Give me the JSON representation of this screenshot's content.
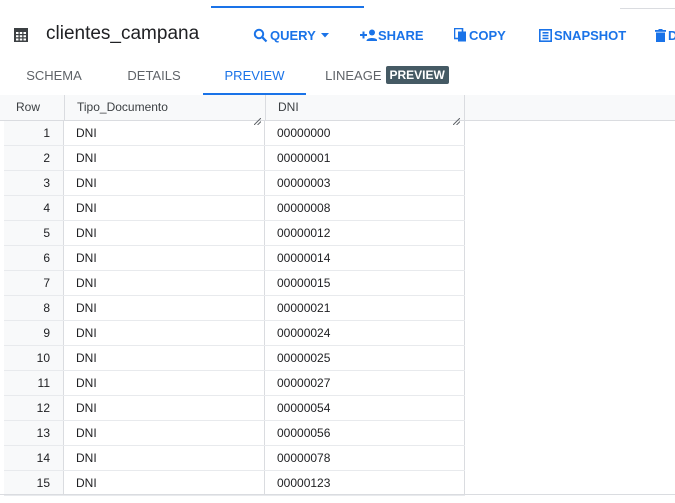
{
  "table": {
    "name": "clientes_campana"
  },
  "toolbar": {
    "query_label": "QUERY",
    "share_label": "SHARE",
    "copy_label": "COPY",
    "snapshot_label": "SNAPSHOT",
    "delete_label": "D"
  },
  "tabs": {
    "schema": "SCHEMA",
    "details": "DETAILS",
    "preview": "PREVIEW",
    "lineage": "LINEAGE",
    "lineage_badge": "PREVIEW",
    "active": "preview"
  },
  "results": {
    "columns": [
      "Row",
      "Tipo_Documento",
      "DNI"
    ],
    "rows": [
      {
        "row": "1",
        "tipo": "DNI",
        "dni": "00000000"
      },
      {
        "row": "2",
        "tipo": "DNI",
        "dni": "00000001"
      },
      {
        "row": "3",
        "tipo": "DNI",
        "dni": "00000003"
      },
      {
        "row": "4",
        "tipo": "DNI",
        "dni": "00000008"
      },
      {
        "row": "5",
        "tipo": "DNI",
        "dni": "00000012"
      },
      {
        "row": "6",
        "tipo": "DNI",
        "dni": "00000014"
      },
      {
        "row": "7",
        "tipo": "DNI",
        "dni": "00000015"
      },
      {
        "row": "8",
        "tipo": "DNI",
        "dni": "00000021"
      },
      {
        "row": "9",
        "tipo": "DNI",
        "dni": "00000024"
      },
      {
        "row": "10",
        "tipo": "DNI",
        "dni": "00000025"
      },
      {
        "row": "11",
        "tipo": "DNI",
        "dni": "00000027"
      },
      {
        "row": "12",
        "tipo": "DNI",
        "dni": "00000054"
      },
      {
        "row": "13",
        "tipo": "DNI",
        "dni": "00000056"
      },
      {
        "row": "14",
        "tipo": "DNI",
        "dni": "00000078"
      },
      {
        "row": "15",
        "tipo": "DNI",
        "dni": "00000123"
      }
    ]
  },
  "colors": {
    "accent": "#1a73e8",
    "badge": "#455a64",
    "border": "#dadce0"
  },
  "icons": [
    "table-icon",
    "search-icon",
    "chevron-down-icon",
    "add-person-icon",
    "copy-icon",
    "snapshot-icon",
    "delete-icon",
    "resize-handle-icon"
  ]
}
